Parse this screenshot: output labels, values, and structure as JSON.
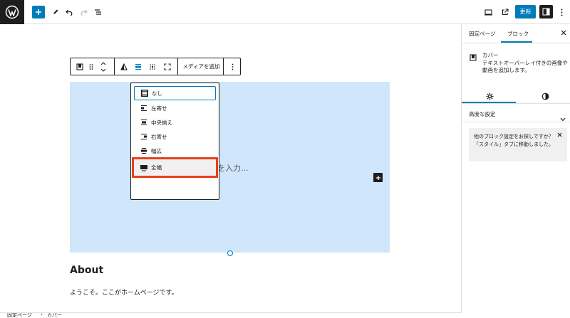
{
  "topbar": {
    "update_label": "更新",
    "icons": [
      "wordpress-logo",
      "add-block-icon",
      "edit-tool-icon",
      "undo-icon",
      "redo-icon",
      "list-view-icon",
      "desktop-preview-icon",
      "external-view-icon",
      "settings-icon",
      "more-menu-icon"
    ]
  },
  "toolbar": {
    "media_label": "メディアを追加"
  },
  "align_menu": {
    "items": [
      {
        "label": "なし",
        "selected": true
      },
      {
        "label": "左寄せ"
      },
      {
        "label": "中央揃え"
      },
      {
        "label": "右寄せ"
      },
      {
        "label": "幅広"
      },
      {
        "label": "全幅",
        "highlighted": true
      }
    ]
  },
  "cover": {
    "placeholder": "ルを入力..."
  },
  "content": {
    "about_heading": "About",
    "welcome_text": "ようこそ。ここがホームページです。"
  },
  "sidebar": {
    "tab_page": "固定ページ",
    "tab_block": "ブロック",
    "block_name": "カバー",
    "block_description": "テキストオーバーレイ付きの画像や動画を追加します。",
    "advanced_label": "高度な設定",
    "notice_text": "他のブロック設定をお探しですか？「スタイル」タブに移動しました。"
  },
  "statusbar": {
    "crumb_page": "固定ページ",
    "separator": "›",
    "crumb_block": "カバー"
  },
  "colors": {
    "accent": "#007cba",
    "highlight": "#e8401c",
    "cover_bg": "#cfe6fb"
  }
}
